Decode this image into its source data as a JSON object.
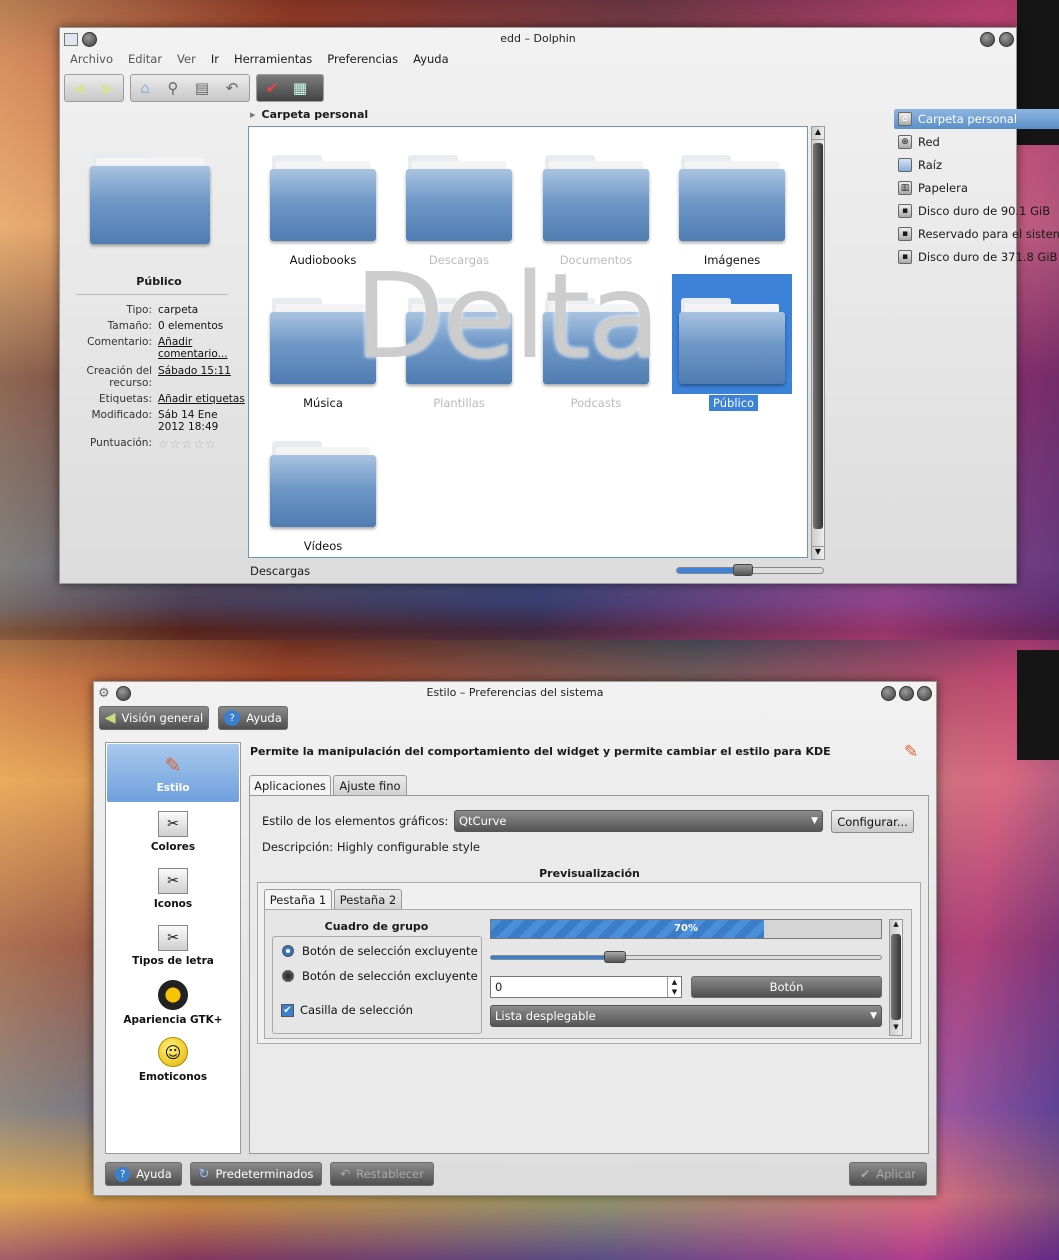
{
  "dolphin": {
    "title": "edd – Dolphin",
    "menu": [
      "Archivo",
      "Editar",
      "Ver",
      "Ir",
      "Herramientas",
      "Preferencias",
      "Ayuda"
    ],
    "breadcrumb": "Carpeta personal",
    "info": {
      "name": "Público",
      "rows": [
        {
          "key": "Tipo:",
          "value": "carpeta"
        },
        {
          "key": "Tamaño:",
          "value": "0 elementos"
        },
        {
          "key": "Comentario:",
          "value": "Añadir comentario..."
        },
        {
          "key": "Creación del recurso:",
          "value": "Sábado 15:11"
        },
        {
          "key": "Etiquetas:",
          "value": "Añadir etiquetas"
        },
        {
          "key": "Modificado:",
          "value": "Sáb 14 Ene 2012 18:49"
        },
        {
          "key": "Puntuación:",
          "value": ""
        }
      ]
    },
    "folders": [
      "Audiobooks",
      "Descargas",
      "Documentos",
      "Imágenes",
      "Música",
      "Plantillas",
      "Podcasts",
      "Público",
      "Vídeos"
    ],
    "places": [
      "Carpeta personal",
      "Red",
      "Raíz",
      "Papelera",
      "Disco duro de 90.1 GiB",
      "Reservado para el sistema",
      "Disco duro de 371.8 GiB"
    ],
    "status": "Descargas",
    "zoom_level": 0.45,
    "overlay": "Delta"
  },
  "settings": {
    "title": "Estilo – Preferencias del sistema",
    "toolbar": {
      "overview": "Visión general",
      "help": "Ayuda"
    },
    "categories": [
      "Estilo",
      "Colores",
      "Iconos",
      "Tipos de letra",
      "Apariencia GTK+",
      "Emoticonos"
    ],
    "header": "Permite la manipulación del comportamiento del widget y permite cambiar el estilo para KDE",
    "tabs": [
      "Aplicaciones",
      "Ajuste fino"
    ],
    "style_label": "Estilo de los elementos gráficos:",
    "style_value": "QtCurve",
    "configure": "Configurar...",
    "description": "Descripción: Highly configurable style",
    "preview": {
      "title": "Previsualización",
      "tabs": [
        "Pestaña 1",
        "Pestaña 2"
      ],
      "group_title": "Cuadro de grupo",
      "radio1": "Botón de selección excluyente",
      "radio2": "Botón de selección excluyente",
      "checkbox": "Casilla de selección",
      "progress_label": "70%",
      "progress": 0.7,
      "slider": 0.31,
      "spin_value": "0",
      "button": "Botón",
      "combo": "Lista desplegable"
    },
    "bottom": {
      "help": "Ayuda",
      "defaults": "Predeterminados",
      "reset": "Restablecer",
      "apply": "Aplicar"
    }
  }
}
